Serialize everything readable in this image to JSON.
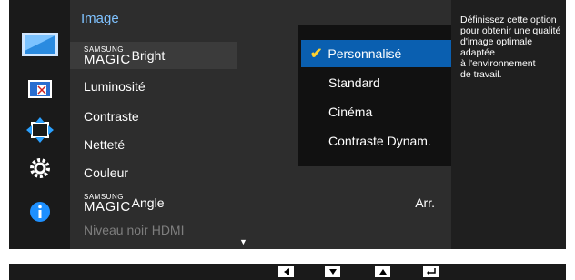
{
  "menu": {
    "title": "Image",
    "items": [
      {
        "brand_small": "SAMSUNG",
        "brand_big": "MAGIC",
        "label": "Bright",
        "value": ""
      },
      {
        "label": "Luminosité",
        "value": ""
      },
      {
        "label": "Contraste",
        "value": ""
      },
      {
        "label": "Netteté",
        "value": ""
      },
      {
        "label": "Couleur",
        "value": ""
      },
      {
        "brand_small": "SAMSUNG",
        "brand_big": "MAGIC",
        "label": "Angle",
        "value": "Arr."
      },
      {
        "label": "Niveau noir HDMI",
        "value": ""
      }
    ],
    "scroll_indicator": "▼"
  },
  "dropdown": {
    "options": [
      "Personnalisé",
      "Standard",
      "Cinéma",
      "Contraste Dynam."
    ],
    "selected": "Personnalisé",
    "check": "✔"
  },
  "info": {
    "lines": [
      "Définissez cette option",
      "pour obtenir une qualité",
      "d'image optimale adaptée",
      "à l'environnement",
      "de travail."
    ]
  },
  "icons": [
    "picture-icon",
    "screen-size-icon",
    "resize-icon",
    "settings-gear-icon",
    "info-icon"
  ],
  "buttons": [
    "left-arrow",
    "down-arrow",
    "up-arrow",
    "enter"
  ],
  "colors": {
    "accent": "#0a5fb0",
    "title": "#7fc2ff",
    "check": "#ffd22e",
    "info_icon": "#1e90ff"
  }
}
